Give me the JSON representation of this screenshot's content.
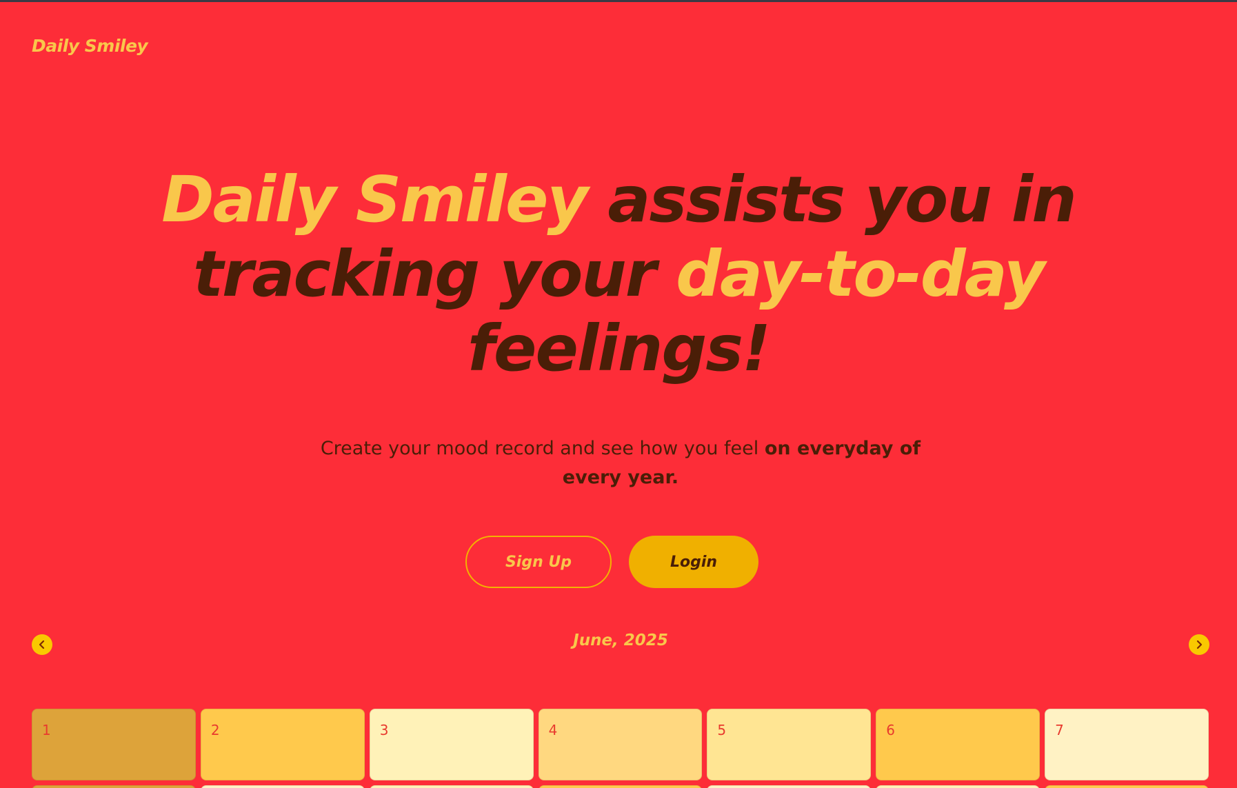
{
  "brand": "Daily Smiley",
  "hero": {
    "part1": "Daily Smiley",
    "part2": " assists you in tracking your ",
    "part3": "day-to-day",
    "part4": " feelings!"
  },
  "subtitle": {
    "normal": "Create your mood record and see how you feel ",
    "bold": "on everyday of every year."
  },
  "buttons": {
    "signup": "Sign Up",
    "login": "Login"
  },
  "calendar": {
    "month_label": "June, 2025",
    "days": [
      {
        "label": "1",
        "color": "#dda33a"
      },
      {
        "label": "2",
        "color": "#ffc94c"
      },
      {
        "label": "3",
        "color": "#fff2b8"
      },
      {
        "label": "4",
        "color": "#ffd880"
      },
      {
        "label": "5",
        "color": "#ffe593"
      },
      {
        "label": "6",
        "color": "#ffc94c"
      },
      {
        "label": "7",
        "color": "#fff2c4"
      }
    ],
    "next_row_colors": [
      "#dda33a",
      "#fff2c4",
      "#fff2b8",
      "#ffc94c",
      "#fff2c4",
      "#fff2b8",
      "#ffc94c"
    ]
  },
  "icons": {
    "prev": "chevron-left-icon",
    "next": "chevron-right-icon"
  },
  "colors": {
    "background": "#fd2d38",
    "accent_yellow": "#f9c74b",
    "dark_brown": "#4a1e07",
    "login_bg": "#f0b000",
    "nav_circle": "#f9c900"
  }
}
